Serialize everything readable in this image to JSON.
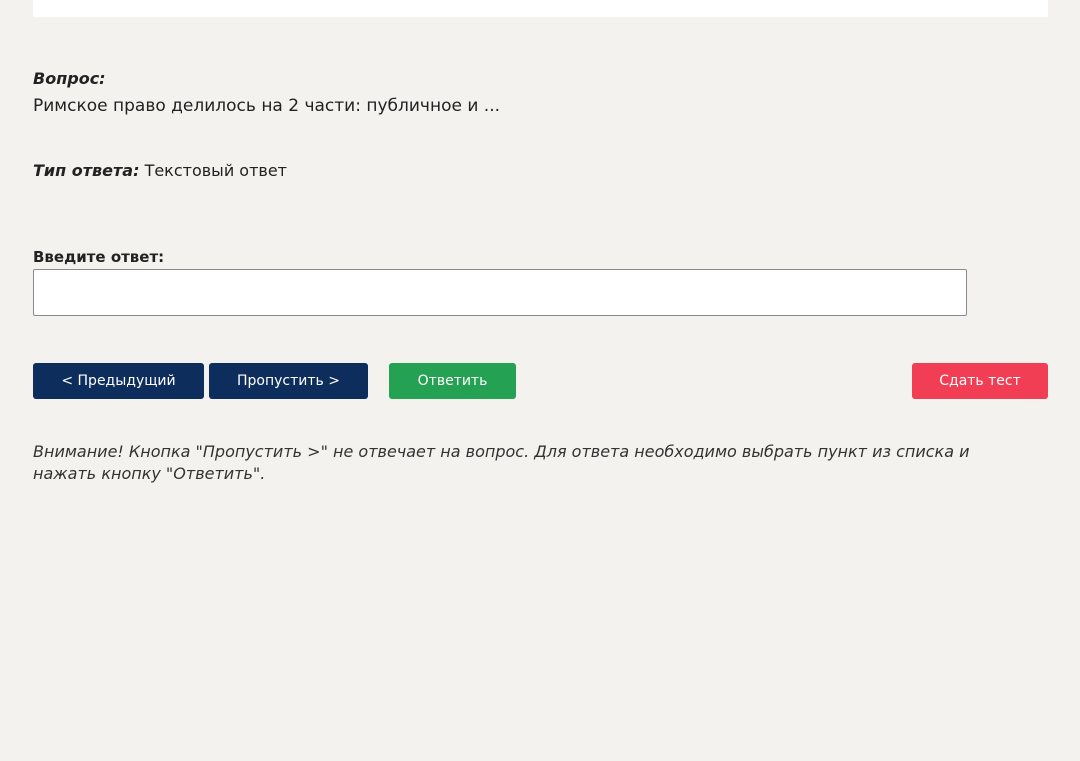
{
  "question": {
    "label": "Вопрос:",
    "text": "Римское право делилось на 2 части: публичное и ..."
  },
  "answer_type": {
    "label": "Тип ответа:",
    "value": "Текстовый ответ"
  },
  "answer_input": {
    "label": "Введите ответ:",
    "value": "",
    "placeholder": ""
  },
  "buttons": {
    "previous": "< Предыдущий",
    "skip": "Пропустить >",
    "answer": "Ответить",
    "submit_test": "Сдать тест"
  },
  "notice": "Внимание! Кнопка \"Пропустить >\" не отвечает на вопрос. Для ответа необходимо выбрать пункт из списка и нажать кнопку \"Ответить\".",
  "colors": {
    "background": "#f3f2ef",
    "nav_button": "#0d2d5c",
    "answer_button": "#24a152",
    "submit_button": "#f23e55"
  }
}
